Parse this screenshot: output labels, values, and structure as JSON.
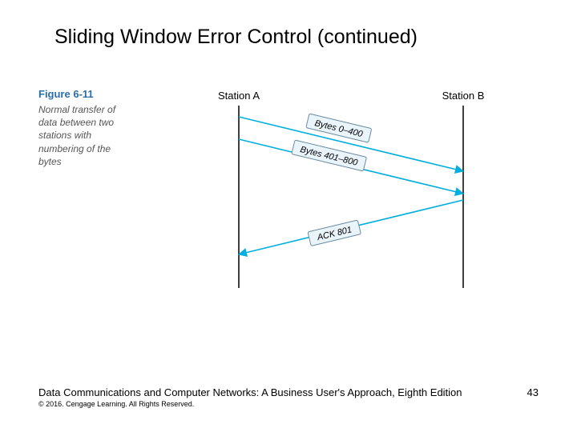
{
  "title": "Sliding Window Error Control (continued)",
  "figure": {
    "number": "Figure 6-11",
    "caption": "Normal transfer of data between two stations with numbering of the bytes",
    "stationA": "Station A",
    "stationB": "Station B",
    "msg1": "Bytes 0–400",
    "msg2": "Bytes 401–800",
    "msg3": "ACK 801"
  },
  "footer": {
    "book": "Data Communications and Computer Networks: A Business User's Approach, Eighth Edition",
    "page": "43",
    "copyright": "© 2016. Cengage Learning. All Rights Reserved."
  }
}
